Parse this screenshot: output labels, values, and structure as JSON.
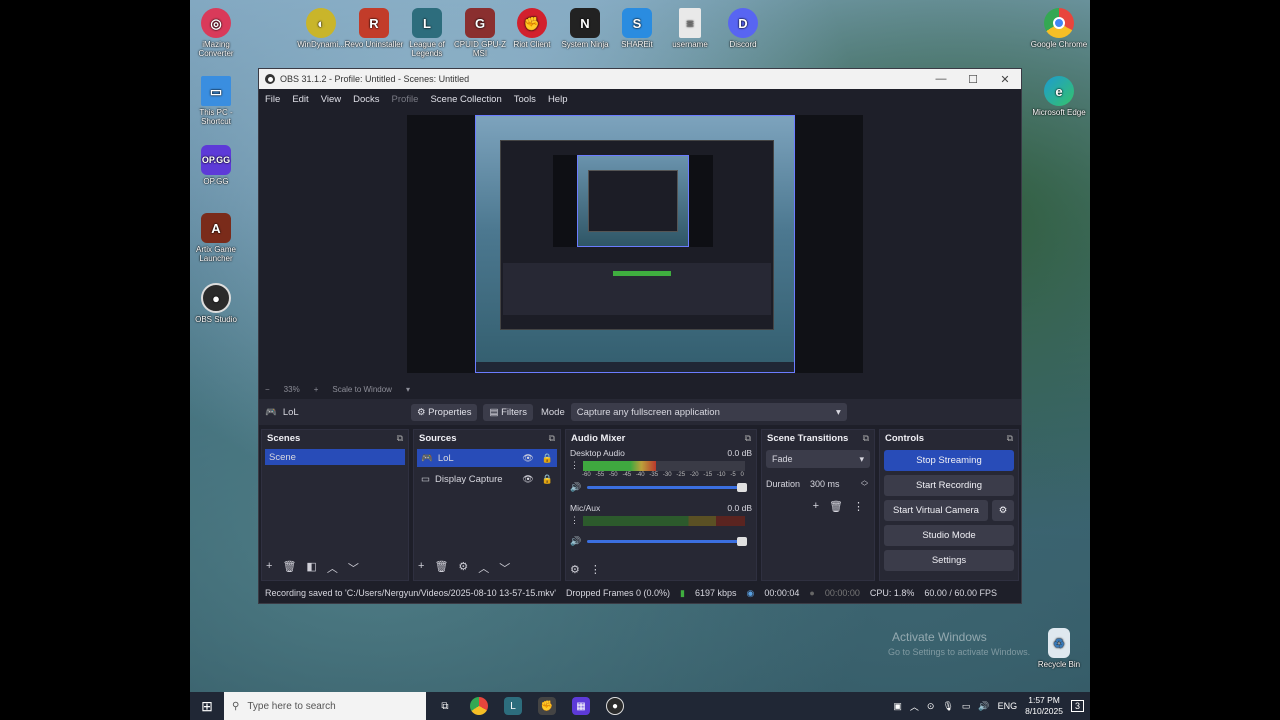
{
  "desktop_icons": [
    {
      "label": "iMazing Converter",
      "icon": "imazing-icon",
      "color": "#d93a5a"
    },
    {
      "label": "WinDynami...",
      "icon": "windynamic-icon",
      "color": "#c9b52a"
    },
    {
      "label": "Revo Uninstaller",
      "icon": "revo-icon",
      "color": "#c23c2a"
    },
    {
      "label": "League of Legends",
      "icon": "lol-icon",
      "color": "#2d6d7d"
    },
    {
      "label": "CPUID GPU-Z MSI",
      "icon": "cpuid-icon",
      "color": "#8a2f2f"
    },
    {
      "label": "Riot Client",
      "icon": "riot-icon",
      "color": "#d2202d"
    },
    {
      "label": "System Ninja",
      "icon": "ninja-icon",
      "color": "#222222"
    },
    {
      "label": "SHAREit",
      "icon": "shareit-icon",
      "color": "#2a8ce0"
    },
    {
      "label": "username",
      "icon": "file-icon",
      "color": "#e9e9e9"
    },
    {
      "label": "Discord",
      "icon": "discord-icon",
      "color": "#5865f2"
    },
    {
      "label": "Google Chrome",
      "icon": "chrome-icon",
      "color": "#e8453c"
    },
    {
      "label": "This PC - Shortcut",
      "icon": "pc-icon",
      "color": "#3a8ee0"
    },
    {
      "label": "OP.GG",
      "icon": "opgg-icon",
      "color": "#5d3ad8"
    },
    {
      "label": "Artix Game Launcher",
      "icon": "artix-icon",
      "color": "#7a2b1a"
    },
    {
      "label": "OBS Studio",
      "icon": "obs-icon",
      "color": "#2b2b2b"
    },
    {
      "label": "Microsoft Edge",
      "icon": "edge-icon",
      "color": "#1d9bd0"
    },
    {
      "label": "Recycle Bin",
      "icon": "recycle-bin-icon",
      "color": "#dfe8ef"
    }
  ],
  "obs": {
    "title": "OBS 31.1.2 - Profile: Untitled - Scenes: Untitled",
    "menu": [
      "File",
      "Edit",
      "View",
      "Docks",
      "Profile",
      "Scene Collection",
      "Tools",
      "Help"
    ],
    "zoom": {
      "minus": "−",
      "value": "33%",
      "plus": "+",
      "scale": "Scale to Window"
    },
    "source_toolbar": {
      "source_name": "LoL",
      "properties": "Properties",
      "filters": "Filters",
      "mode_label": "Mode",
      "mode_value": "Capture any fullscreen application"
    },
    "scenes": {
      "title": "Scenes",
      "items": [
        "Scene"
      ]
    },
    "sources": {
      "title": "Sources",
      "items": [
        "LoL",
        "Display Capture"
      ]
    },
    "mixer": {
      "title": "Audio Mixer",
      "channels": [
        {
          "name": "Desktop Audio",
          "db": "0.0 dB",
          "level": 0.45
        },
        {
          "name": "Mic/Aux",
          "db": "0.0 dB",
          "level": 0.0
        }
      ],
      "ticks": [
        "-60",
        "-55",
        "-50",
        "-45",
        "-40",
        "-35",
        "-30",
        "-25",
        "-20",
        "-15",
        "-10",
        "-5",
        "0"
      ]
    },
    "transitions": {
      "title": "Scene Transitions",
      "type": "Fade",
      "duration_label": "Duration",
      "duration_value": "300 ms"
    },
    "controls": {
      "title": "Controls",
      "stop_streaming": "Stop Streaming",
      "start_recording": "Start Recording",
      "start_virtual_camera": "Start Virtual Camera",
      "studio_mode": "Studio Mode",
      "settings": "Settings"
    },
    "status": {
      "recording_saved": "Recording saved to 'C:/Users/Nergyun/Videos/2025-08-10 13-57-15.mkv'",
      "dropped_frames": "Dropped Frames 0 (0.0%)",
      "kbps": "6197 kbps",
      "stream_time": "00:00:04",
      "rec_time": "00:00:00",
      "cpu": "CPU: 1.8%",
      "fps": "60.00 / 60.00 FPS"
    }
  },
  "taskbar": {
    "search_placeholder": "Type here to search",
    "lang": "ENG",
    "time": "1:57 PM",
    "date": "8/10/2025",
    "notification_count": "3"
  },
  "watermark": {
    "line1": "Activate Windows",
    "line2": "Go to Settings to activate Windows."
  }
}
